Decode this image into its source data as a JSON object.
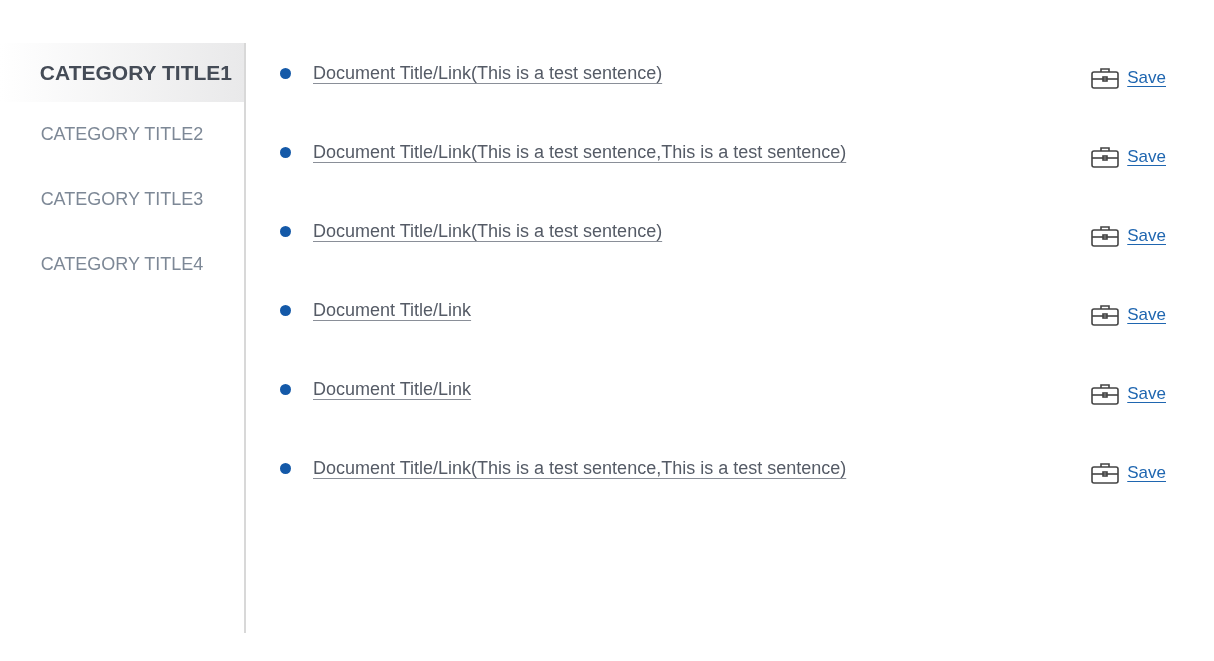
{
  "sidebar": {
    "items": [
      {
        "label": "CATEGORY TITLE1",
        "selected": true
      },
      {
        "label": "CATEGORY TITLE2",
        "selected": false
      },
      {
        "label": "CATEGORY TITLE3",
        "selected": false
      },
      {
        "label": "CATEGORY TITLE4",
        "selected": false
      }
    ]
  },
  "documents": [
    {
      "title": "Document Title/Link(This is a test sentence)",
      "action": "Save"
    },
    {
      "title": "Document Title/Link(This is a test sentence,This is a test sentence)",
      "action": "Save"
    },
    {
      "title": "Document Title/Link(This is a test sentence)",
      "action": "Save"
    },
    {
      "title": "Document Title/Link",
      "action": "Save"
    },
    {
      "title": "Document Title/Link",
      "action": "Save"
    },
    {
      "title": "Document Title/Link(This is a test sentence,This is a test sentence)",
      "action": "Save"
    }
  ]
}
